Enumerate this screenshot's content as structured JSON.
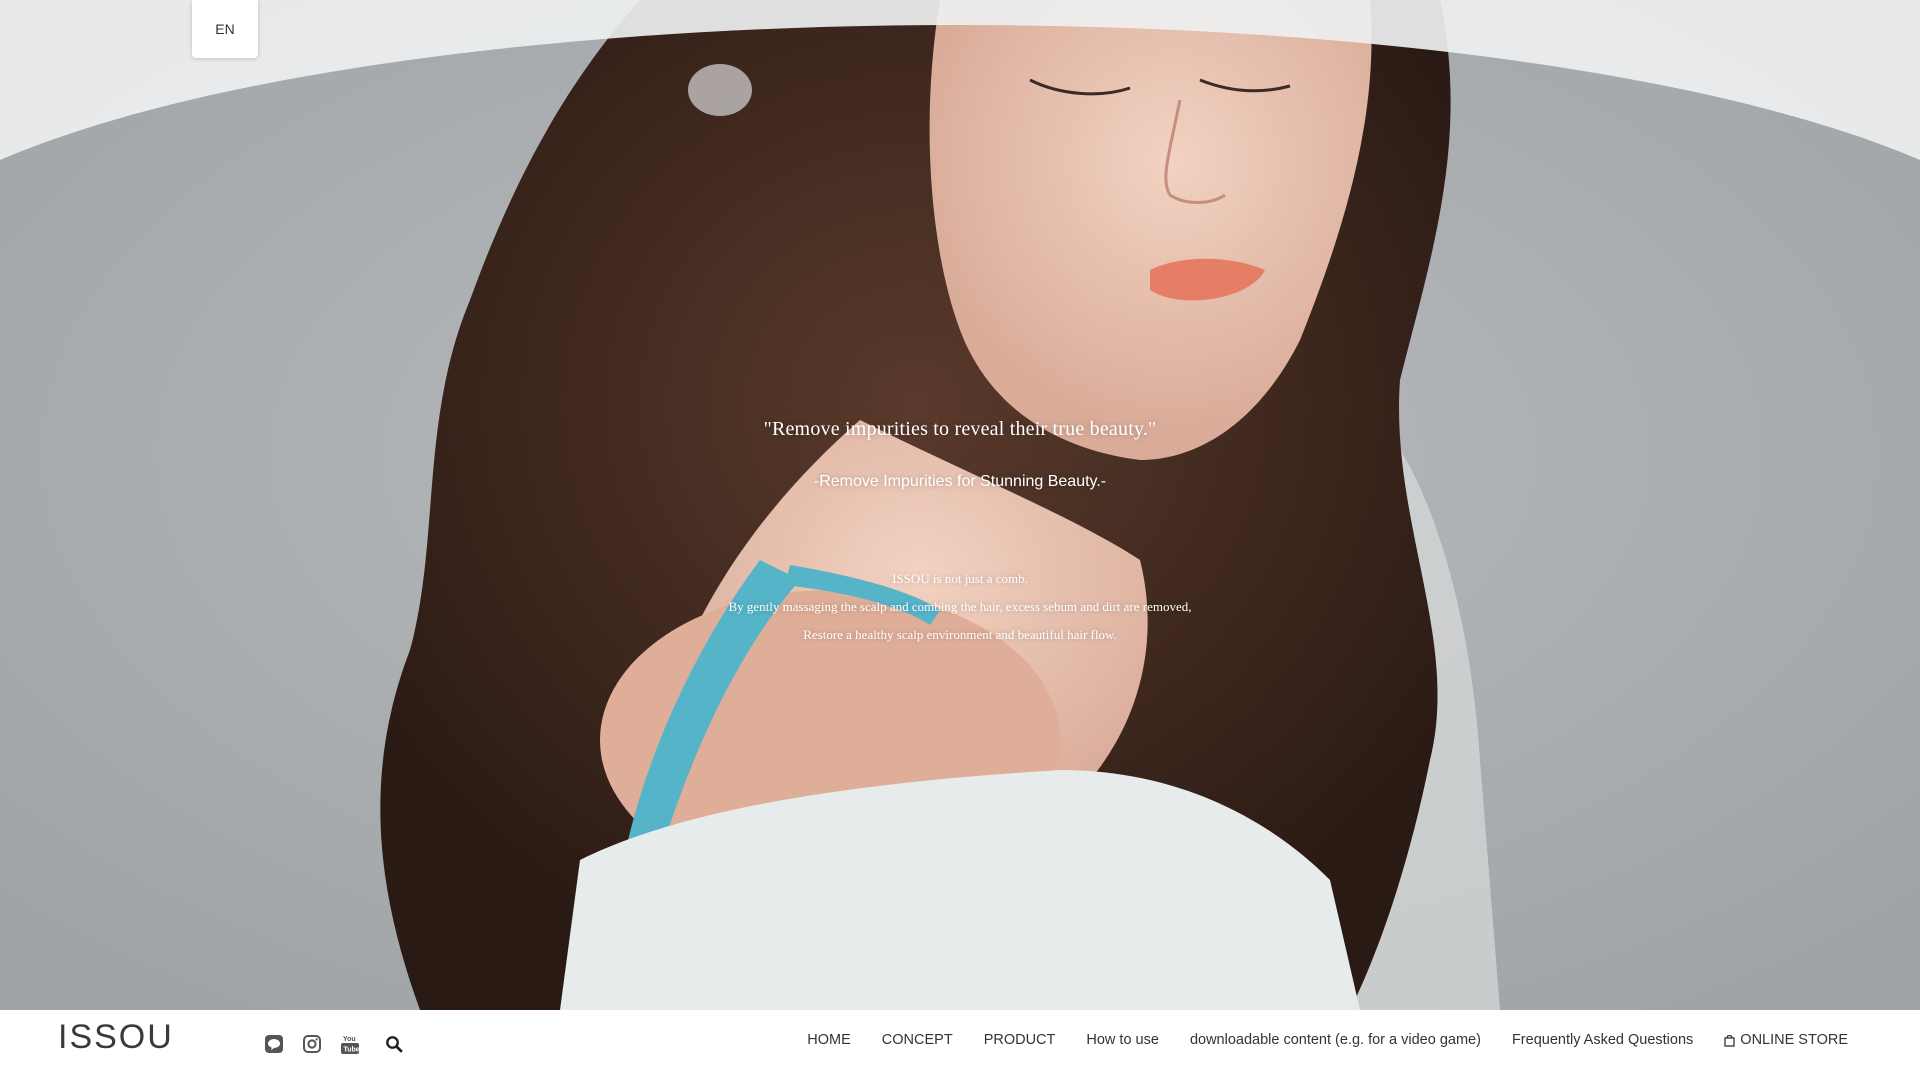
{
  "language": {
    "current": "EN"
  },
  "hero": {
    "title": "\"Remove impurities to reveal their true beauty.\"",
    "subtitle": "-Remove Impurities for Stunning Beauty.-",
    "body": [
      "ISSOU is not just a comb.",
      "By gently massaging the scalp and combing the hair, excess sebum and dirt are removed,",
      "Restore a healthy scalp environment and beautiful hair flow."
    ]
  },
  "header": {
    "logo": "ISSOU"
  },
  "social": [
    {
      "icon": "line-icon"
    },
    {
      "icon": "instagram-icon"
    },
    {
      "icon": "youtube-icon"
    },
    {
      "icon": "search-icon"
    }
  ],
  "nav": {
    "items": [
      {
        "label": "HOME"
      },
      {
        "label": "CONCEPT"
      },
      {
        "label": "PRODUCT"
      },
      {
        "label": "How to use"
      },
      {
        "label": "downloadable content (e.g. for a video game)"
      },
      {
        "label": "Frequently Asked Questions"
      },
      {
        "label": "ONLINE STORE",
        "icon": "shopping-bag-icon"
      }
    ]
  },
  "colors": {
    "background_grey": "#a9acae",
    "top_arc": "#eef0f0",
    "text_dark": "#333333",
    "hero_text": "#ffffff"
  }
}
